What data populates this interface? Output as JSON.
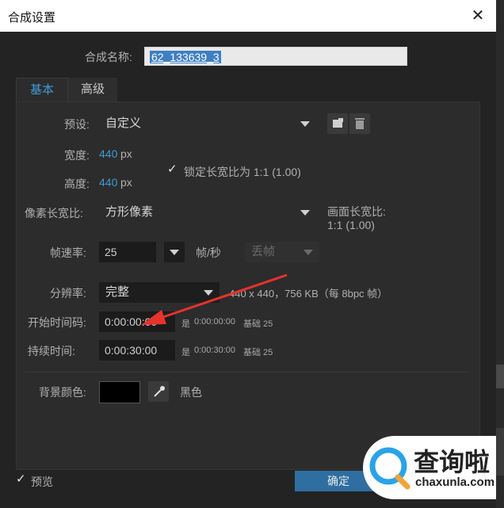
{
  "window": {
    "title": "合成设置",
    "close": "✕"
  },
  "comp_name": {
    "label": "合成名称:",
    "value": "62_133639_3"
  },
  "tabs": [
    {
      "label": "基本"
    },
    {
      "label": "高级"
    }
  ],
  "preset": {
    "label": "预设:",
    "value": "自定义"
  },
  "width": {
    "label": "宽度:",
    "value": "440",
    "unit": "px"
  },
  "height": {
    "label": "高度:",
    "value": "440",
    "unit": "px"
  },
  "lock_aspect": {
    "check": "✓",
    "label": "锁定长宽比为 1:1 (1.00)"
  },
  "pixel_aspect": {
    "label": "像素长宽比:",
    "value": "方形像素"
  },
  "frame_aspect": {
    "label": "画面长宽比:",
    "value": "1:1 (1.00)"
  },
  "frame_rate": {
    "label": "帧速率:",
    "value": "25",
    "unit": "帧/秒",
    "drop": "丢帧"
  },
  "resolution": {
    "label": "分辨率:",
    "value": "完整",
    "info": "440 x 440，756 KB（每 8bpc 帧）"
  },
  "start_tc": {
    "label": "开始时间码:",
    "value": "0:00:00:00",
    "is": "是",
    "tc": "0:00:00:00",
    "base": "基础 25"
  },
  "duration": {
    "label": "持续时间:",
    "value": "0:00:30:00",
    "is": "是",
    "tc": "0:00:30:00",
    "base": "基础 25"
  },
  "bg_color": {
    "label": "背景颜色:",
    "name": "黑色",
    "swatch": "#000000"
  },
  "preview": {
    "check": "✓",
    "label": "预览"
  },
  "ok_button": "确定",
  "watermark": {
    "brand": "查询啦",
    "url": "chaxunla.com"
  },
  "colors": {
    "accent": "#3e9bd6",
    "ok": "#2f6ea0",
    "arrow": "#e8322c"
  }
}
